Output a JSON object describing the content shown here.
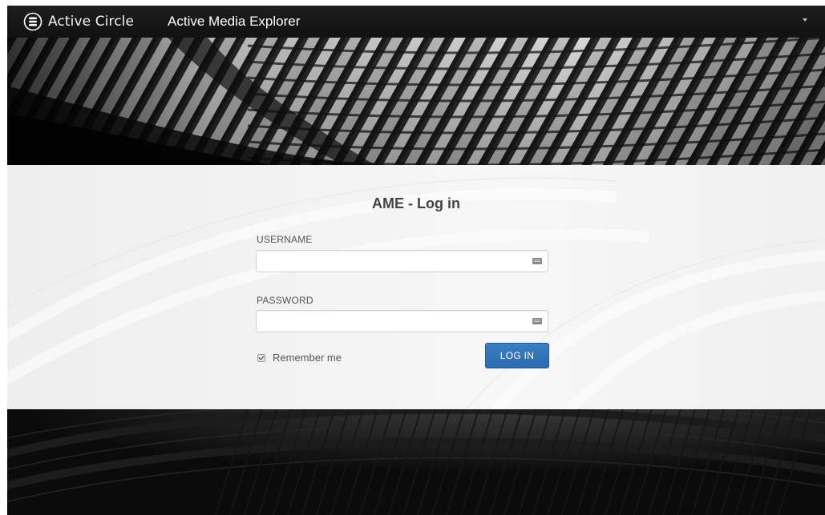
{
  "navbar": {
    "brand_name": "Active Circle",
    "app_title": "Active Media Explorer",
    "logo_icon": "stacked-disks-icon",
    "menu_icon": "caret-down-icon"
  },
  "login": {
    "title": "AME - Log in",
    "username_label": "USERNAME",
    "username_value": "",
    "password_label": "PASSWORD",
    "password_value": "",
    "field_icon": "keyboard-icon",
    "remember_label": "Remember me",
    "remember_checked": true,
    "submit_label": "LOG IN"
  },
  "colors": {
    "navbar_bg": "#161616",
    "band_bg": "#f2f2f2",
    "button_bg": "#2f73b9",
    "title_text": "#444444"
  }
}
